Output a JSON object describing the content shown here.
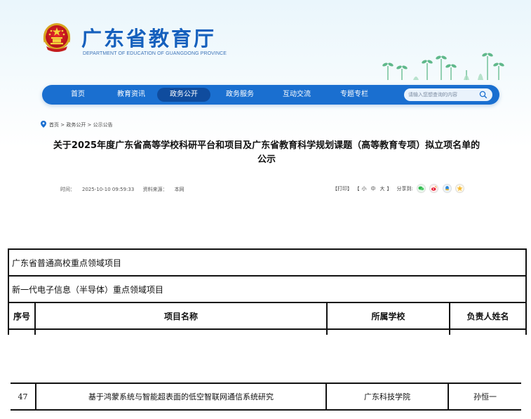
{
  "header": {
    "title": "广东省教育厅",
    "subtitle": "DEPARTMENT OF EDUCATION OF GUANGDONG PROVINCE",
    "emblem_icon": "national-emblem-icon"
  },
  "nav": {
    "items": [
      {
        "label": "首页"
      },
      {
        "label": "教育资讯"
      },
      {
        "label": "政务公开"
      },
      {
        "label": "政务服务"
      },
      {
        "label": "互动交流"
      },
      {
        "label": "专题专栏"
      }
    ],
    "active": "政务公开",
    "search_placeholder": "请输入您想查询的内容",
    "bar_color": "#1a6fd0",
    "active_color": "#0f4c9e"
  },
  "breadcrumb": {
    "items": [
      "首页",
      "政务公开",
      "公示公告"
    ],
    "separator": " > "
  },
  "article": {
    "title": "关于2025年度广东省高等学校科研平台和项目及广东省教育科学规划课题（高等教育专项）拟立项名单的公示",
    "time_label": "时间：",
    "time": "2025-10-10 09:59:33",
    "source_label": "资料来源：",
    "source": "本网",
    "print": "【打印】",
    "font_open": "【",
    "font_small": "小",
    "font_medium": "中",
    "font_large": "大",
    "font_close": "】",
    "share_label": "分享到:",
    "share_icons": [
      "wechat-icon",
      "weibo-icon",
      "qq-icon",
      "qzone-icon"
    ]
  },
  "table": {
    "section1": "广东省普通高校重点领域项目",
    "section2": "新一代电子信息（半导体）重点领域项目",
    "columns": [
      "序号",
      "项目名称",
      "所属学校",
      "负责人姓名"
    ],
    "rows": [
      {
        "no": "47",
        "name": "基于鸿蒙系统与智能超表面的低空智联网通信系统研究",
        "school": "广东科技学院",
        "leader": "孙恒一"
      }
    ]
  }
}
